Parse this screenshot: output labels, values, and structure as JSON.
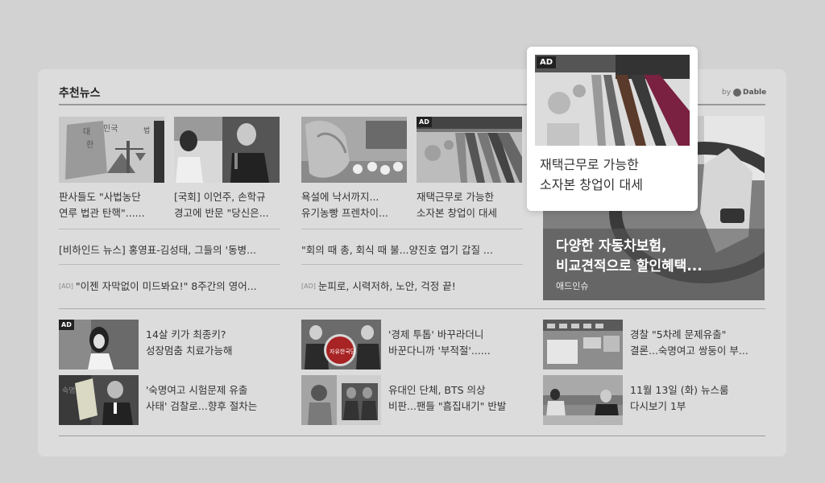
{
  "widget": {
    "title": "추천뉴스",
    "by": "by",
    "brand": "Dable"
  },
  "cards": [
    {
      "text": "판사들도 \"사법농단\n연루 법관 탄핵\"......",
      "ad": false
    },
    {
      "text": "[국회] 이언주, 손학규\n경고에 반문 \"당신은...",
      "ad": false
    },
    {
      "text": "욕설에 낙서까지...\n유기농빵 프렌차이...",
      "ad": false
    },
    {
      "text": "재택근무로 가능한\n소자본 창업이 대세",
      "ad": true,
      "badge": "AD"
    }
  ],
  "list": [
    {
      "text": "[비하인드 뉴스] 홍영표-김성태, 그들의 '동병...",
      "ad": false
    },
    {
      "text": "\"회의 때 총, 회식 때 불...양진호 엽기 갑질 ...",
      "ad": false
    },
    {
      "text": "\"이젠 자막없이 미드봐요!\" 8주간의 영어...",
      "ad": true,
      "tag": "[AD]"
    },
    {
      "text": "눈피로, 시력저하, 노안, 걱정 끝!",
      "ad": true,
      "tag": "[AD]"
    }
  ],
  "big_ad": {
    "headline": "다양한 자동차보험,\n비교견적으로 할인혜택...",
    "sponsor": "애드인슈"
  },
  "popup": {
    "badge": "AD",
    "text": "재택근무로 가능한\n소자본 창업이 대세"
  },
  "bottom": [
    {
      "text": "14살 키가 최종키?\n성장멈춤 치료가능해",
      "ad": true,
      "badge": "AD"
    },
    {
      "text": "'경제 투톱' 바꾸라더니\n바꾼다니까 '부적절'......",
      "ad": false
    },
    {
      "text": "경찰 \"5차례 문제유출\"\n결론...숙명여고 쌍둥이 부...",
      "ad": false
    },
    {
      "text": "'숙명여고 시험문제 유출\n사태' 검찰로...향후 절차는",
      "ad": false
    },
    {
      "text": "유대인 단체, BTS 의상\n비판...팬들 \"흠집내기\" 반발",
      "ad": false
    },
    {
      "text": "11월 13일 (화) 뉴스룸\n다시보기 1부",
      "ad": false
    }
  ]
}
